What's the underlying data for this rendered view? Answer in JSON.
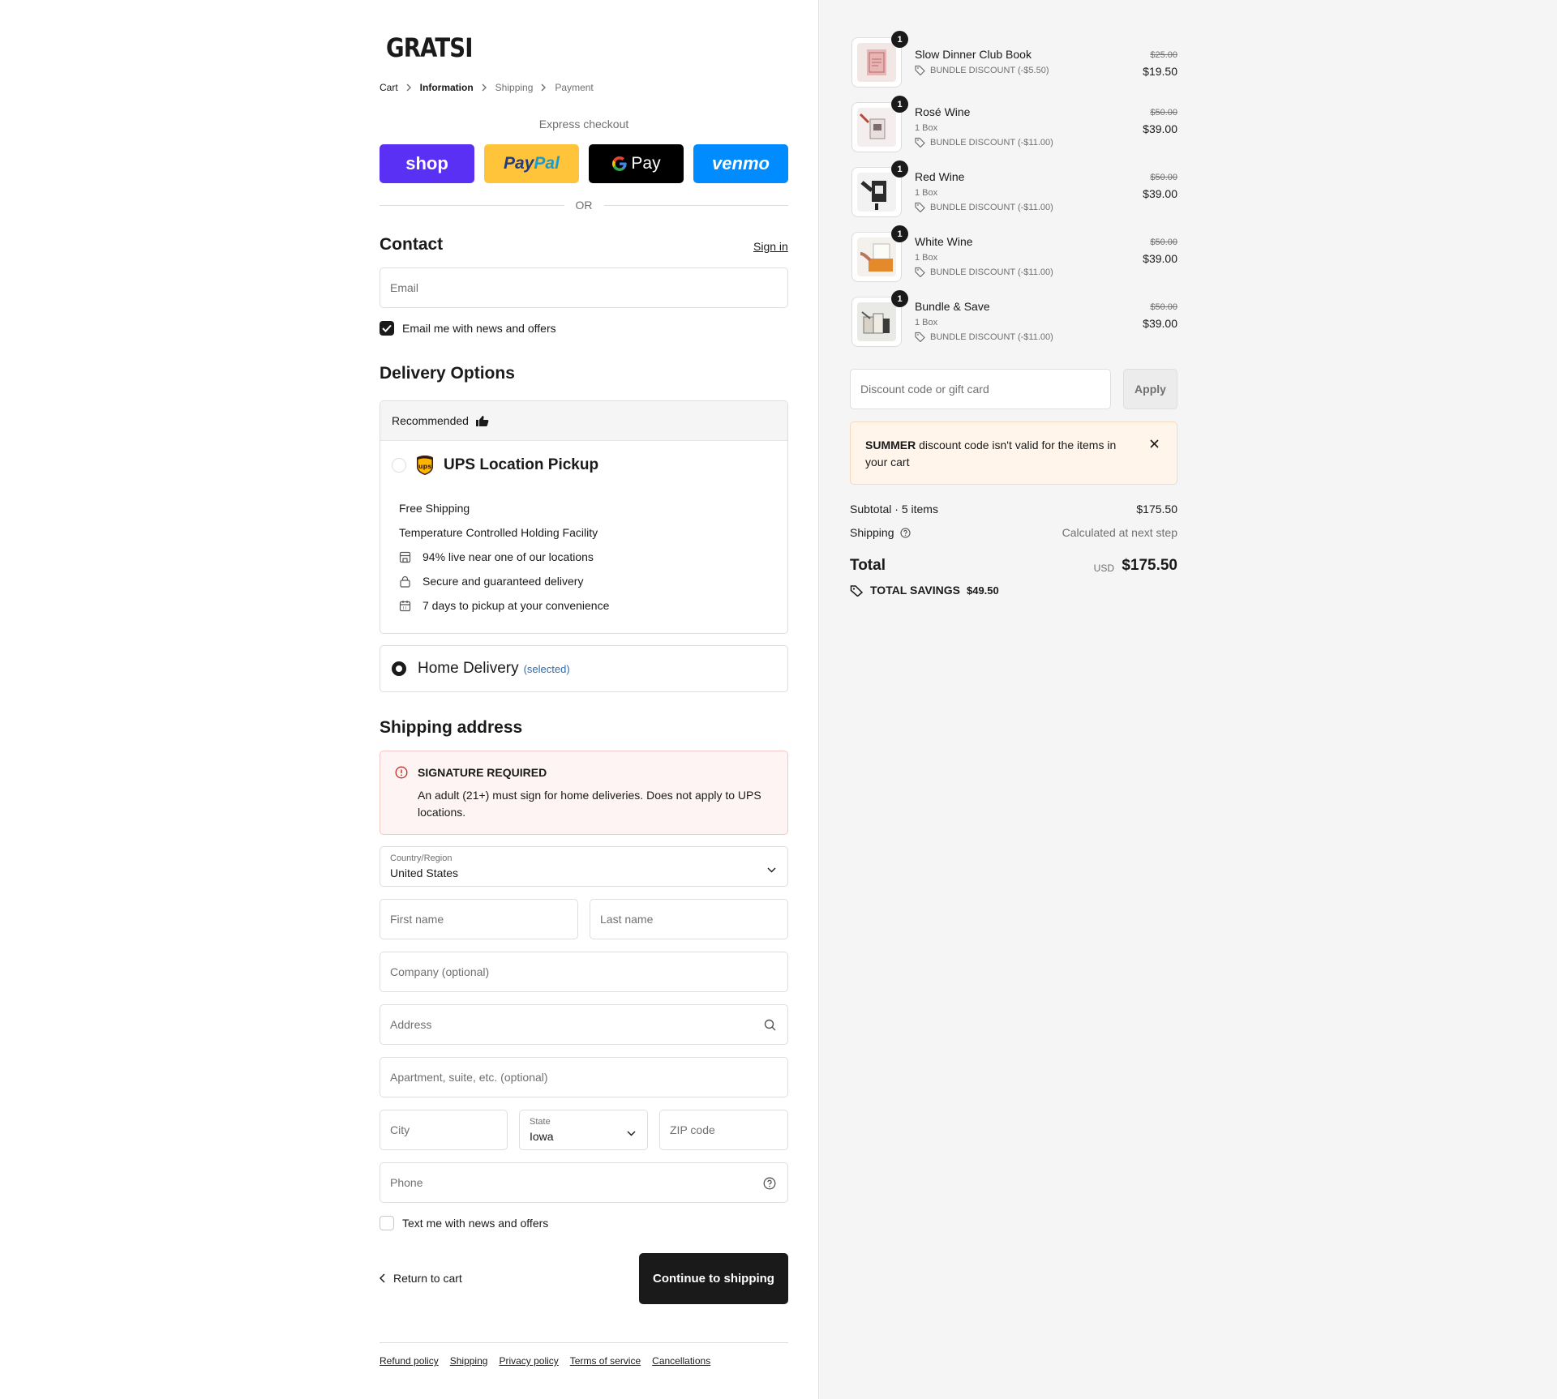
{
  "brand": {
    "logo": "GRATSI"
  },
  "breadcrumb": [
    "Cart",
    "Information",
    "Shipping",
    "Payment"
  ],
  "express": {
    "title": "Express checkout",
    "buttons": {
      "shop": "shop",
      "paypal_a": "Pay",
      "paypal_b": "Pal",
      "gpay": "Pay",
      "venmo": "venmo"
    },
    "or": "OR"
  },
  "contact": {
    "heading": "Contact",
    "signin": "Sign in",
    "email_placeholder": "Email",
    "email_optin": "Email me with news and offers",
    "email_optin_checked": true
  },
  "delivery": {
    "heading": "Delivery Options",
    "recommended": "Recommended",
    "ups": {
      "logo": "ups",
      "title": "UPS Location Pickup",
      "line1": "Free Shipping",
      "line2": "Temperature Controlled Holding Facility",
      "features": [
        {
          "icon": "store-icon",
          "text": "94% live near one of our locations"
        },
        {
          "icon": "lock-icon",
          "text": "Secure and guaranteed delivery"
        },
        {
          "icon": "calendar-icon",
          "text": "7 days to pickup at your convenience"
        }
      ]
    },
    "home": {
      "label": "Home Delivery",
      "selected": "(selected)"
    }
  },
  "shipping": {
    "heading": "Shipping address",
    "signature": {
      "title": "SIGNATURE REQUIRED",
      "text": "An adult (21+) must sign for home deliveries. Does not apply to UPS locations."
    },
    "country": {
      "label": "Country/Region",
      "value": "United States"
    },
    "first_name": "First name",
    "last_name": "Last name",
    "company": "Company (optional)",
    "address": "Address",
    "apartment": "Apartment, suite, etc. (optional)",
    "city": "City",
    "state": {
      "label": "State",
      "value": "Iowa"
    },
    "zip": "ZIP code",
    "phone": "Phone",
    "sms_optin": "Text me with news and offers",
    "sms_optin_checked": false
  },
  "actions": {
    "back": "Return to cart",
    "continue": "Continue to shipping"
  },
  "footer": [
    "Refund policy",
    "Shipping",
    "Privacy policy",
    "Terms of service",
    "Cancellations"
  ],
  "cart": {
    "items": [
      {
        "name": "Slow Dinner Club Book",
        "variant": "",
        "qty": "1",
        "discount": "BUNDLE DISCOUNT (-$5.50)",
        "old_price": "$25.00",
        "price": "$19.50"
      },
      {
        "name": "Rosé Wine",
        "variant": "1 Box",
        "qty": "1",
        "discount": "BUNDLE DISCOUNT (-$11.00)",
        "old_price": "$50.00",
        "price": "$39.00"
      },
      {
        "name": "Red Wine",
        "variant": "1 Box",
        "qty": "1",
        "discount": "BUNDLE DISCOUNT (-$11.00)",
        "old_price": "$50.00",
        "price": "$39.00"
      },
      {
        "name": "White Wine",
        "variant": "1 Box",
        "qty": "1",
        "discount": "BUNDLE DISCOUNT (-$11.00)",
        "old_price": "$50.00",
        "price": "$39.00"
      },
      {
        "name": "Bundle & Save",
        "variant": "1 Box",
        "qty": "1",
        "discount": "BUNDLE DISCOUNT (-$11.00)",
        "old_price": "$50.00",
        "price": "$39.00"
      }
    ],
    "discount_placeholder": "Discount code or gift card",
    "apply": "Apply",
    "warning": {
      "code": "SUMMER",
      "text": " discount code isn't valid for the items in your cart"
    },
    "subtotal_label": "Subtotal · 5 items",
    "subtotal": "$175.50",
    "shipping_label": "Shipping",
    "shipping_value": "Calculated at next step",
    "total_label": "Total",
    "currency": "USD",
    "total": "$175.50",
    "savings_label": "TOTAL SAVINGS",
    "savings": "$49.50"
  },
  "colors": {
    "shop": "#5a31f4",
    "paypal": "#ffc439",
    "venmo": "#008cff",
    "link": "#2b6cb0",
    "dark": "#1a1a1a"
  }
}
